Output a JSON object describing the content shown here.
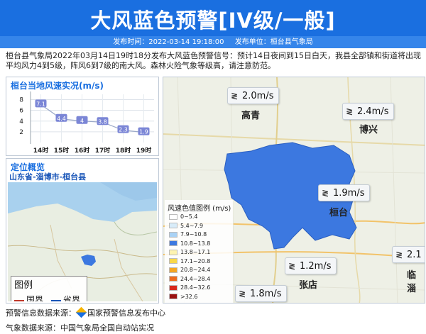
{
  "header": {
    "title": "大风蓝色预警[IV级/一般]",
    "publish_time": "发布时间：2022-03-14 19:18:00",
    "publisher": "发布单位：桓台县气象局"
  },
  "description": "桓台县气象局2022年03月14日19时18分发布大风蓝色预警信号：预计14日夜间到15日白天，我县全部镇和街道将出现平均风力4到5级，阵风6到7级的南大风。森林火险气象等级高，请注意防范。",
  "wind_panel": {
    "title": "桓台当地风速实况(m/s)"
  },
  "chart_data": {
    "type": "line",
    "title": "桓台当地风速实况(m/s)",
    "categories": [
      "14时",
      "15时",
      "16时",
      "17时",
      "18时",
      "19时"
    ],
    "values": [
      7.1,
      4.4,
      4,
      3.8,
      2.3,
      1.9
    ],
    "labels": [
      "7.1",
      "4.4",
      "4",
      "3.8",
      "2.3",
      "1.9"
    ],
    "yticks": [
      "2",
      "4",
      "6",
      "8"
    ],
    "ylim": [
      0,
      9
    ],
    "grid": true
  },
  "location": {
    "title": "定位概览",
    "path": "山东省-淄博市-桓台县",
    "legend_title": "图例",
    "legend_national": "国界",
    "legend_provincial": "省界",
    "color_national": "#c0392b",
    "color_provincial": "#1a56b8"
  },
  "map": {
    "cities": [
      {
        "name": "高青"
      },
      {
        "name": "博兴"
      },
      {
        "name": "桓台"
      },
      {
        "name": "张店"
      },
      {
        "name": "临淄"
      }
    ],
    "wind_tags": [
      {
        "value": "2.0m/s"
      },
      {
        "value": "2.4m/s"
      },
      {
        "value": "1.9m/s"
      },
      {
        "value": "1.2m/s"
      },
      {
        "value": "1.8m/s"
      },
      {
        "value": "2.1"
      }
    ],
    "region_color": "#3c78e0",
    "legend_title": "风速色值图例 (m/s)",
    "legend": [
      {
        "label": "0~5.4",
        "color": "#ffffff"
      },
      {
        "label": "5.4~7.9",
        "color": "#d8ecf9"
      },
      {
        "label": "7.9~10.8",
        "color": "#a9d2f5"
      },
      {
        "label": "10.8~13.8",
        "color": "#3c78e0"
      },
      {
        "label": "13.8~17.1",
        "color": "#fdf3b0"
      },
      {
        "label": "17.1~20.8",
        "color": "#f8d84a"
      },
      {
        "label": "20.8~24.4",
        "color": "#f5a623"
      },
      {
        "label": "24.4~28.4",
        "color": "#ee6b1e"
      },
      {
        "label": "28.4~32.6",
        "color": "#d8281c"
      },
      {
        "label": ">32.6",
        "color": "#9a1111"
      }
    ]
  },
  "footer": {
    "source1_label": "预警信息数据来源：",
    "source1_value": "国家预警信息发布中心",
    "source2": "气象数据来源：中国气象局全国自动站实况"
  }
}
